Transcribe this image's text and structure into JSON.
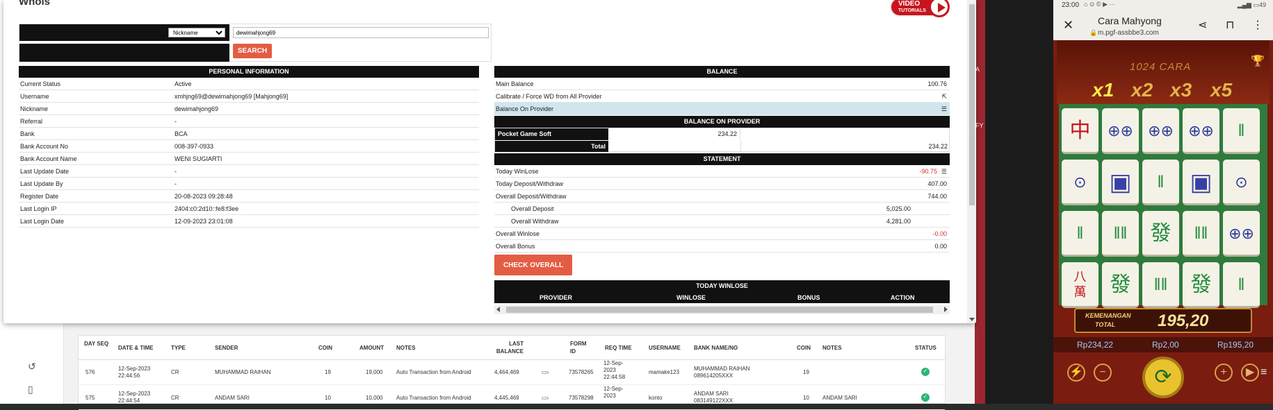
{
  "modal": {
    "title": "Whois",
    "video": {
      "line1": "VIDEO",
      "line2": "TUTORIALS"
    },
    "search": {
      "type_selected": "Nickname",
      "value": "dewimahjong69",
      "button": "SEARCH"
    }
  },
  "personal": {
    "header": "PERSONAL INFORMATION",
    "rows": [
      {
        "k": "Current Status",
        "v": "Active"
      },
      {
        "k": "Username",
        "v": "xmhjng69@dewimahjong69  [Mahjong69]"
      },
      {
        "k": "Nickname",
        "v": "dewimahjong69"
      },
      {
        "k": "Referral",
        "v": "-"
      },
      {
        "k": "Bank",
        "v": "BCA"
      },
      {
        "k": "Bank Account No",
        "v": "008-397-0933"
      },
      {
        "k": "Bank Account Name",
        "v": "WENI SUGIARTI"
      },
      {
        "k": "Last Update Date",
        "v": "-"
      },
      {
        "k": "Last Update By",
        "v": "-"
      },
      {
        "k": "Register Date",
        "v": "20-08-2023 09:28:48"
      },
      {
        "k": "Last Login IP",
        "v": "2404:c0:2d10::fe8:f3ee"
      },
      {
        "k": "Last Login Date",
        "v": "12-09-2023 23:01:08"
      }
    ]
  },
  "balance": {
    "header": "BALANCE",
    "main_k": "Main Balance",
    "main_v": "100.76",
    "calibrate_k": "Calibrate / Force WD from All Provider",
    "onprov_k": "Balance On Provider",
    "onprov_header": "BALANCE ON PROVIDER",
    "provider_name": "Pocket Game Soft",
    "provider_val": "234.22",
    "total_k": "Total",
    "total_v": "234.22"
  },
  "statement": {
    "header": "STATEMENT",
    "today_winlose_k": "Today WinLose",
    "today_winlose_v": "-90.75",
    "today_dw_k": "Today Deposit/Withdraw",
    "today_dw_v": "407.00",
    "overall_dw_k": "Overall Deposit/Withdraw",
    "overall_dw_v": "744.00",
    "overall_dep_k": "Overall Deposit",
    "overall_dep_v": "5,025.00",
    "overall_wd_k": "Overall Withdraw",
    "overall_wd_v": "4,281.00",
    "overall_winlose_k": "Overall Winlose",
    "overall_winlose_v": "-0.00",
    "overall_bonus_k": "Overall Bonus",
    "overall_bonus_v": "0.00",
    "check_button": "CHECK OVERALL"
  },
  "today_winlose": {
    "header": "TODAY WINLOSE",
    "columns": [
      "PROVIDER",
      "WINLOSE",
      "BONUS",
      "ACTION"
    ]
  },
  "transactions": {
    "headers": {
      "day_seq": "DAY SEQ",
      "datetime": "DATE & TIME",
      "type": "TYPE",
      "sender": "SENDER",
      "coin": "COIN",
      "amount": "AMOUNT",
      "notes": "NOTES",
      "last_balance": "LAST BALANCE",
      "form_id": "FORM ID",
      "req_time": "REQ TIME",
      "username": "USERNAME",
      "bank": "BANK NAME/NO",
      "coin2": "COIN",
      "notes2": "NOTES",
      "status": "STATUS"
    },
    "rows": [
      {
        "seq": "576",
        "date": "12-Sep-2023",
        "time": "22:44:56",
        "type": "CR",
        "sender": "MUHAMMAD RAIHAN",
        "coin": "19",
        "amount": "19,000",
        "notes": "Auto Transaction from Android",
        "balance": "4,464,469",
        "form": "73578265",
        "req1": "12-Sep-",
        "req2": "2023",
        "req3": "22:44:58",
        "user": "mamake123",
        "bank1": "MUHAMMAD RAIHAN",
        "bank2": "089614205XXX",
        "coin2": "19",
        "notes2": ""
      },
      {
        "seq": "575",
        "date": "12-Sep-2023",
        "time": "22:44:54",
        "type": "CR",
        "sender": "ANDAM SARI",
        "coin": "10",
        "amount": "10,000",
        "notes": "Auto Transaction from Android",
        "balance": "4,445,469",
        "form": "73578298",
        "req1": "12-Sep-",
        "req2": "2023",
        "req3": "",
        "user": "konto",
        "bank1": "ANDAM SARI",
        "bank2": "083149122XXX",
        "coin2": "10",
        "notes2": "ANDAM SARI"
      }
    ]
  },
  "right_strip": {
    "chars": [
      "A",
      "FY"
    ]
  },
  "phone": {
    "time": "23:00",
    "battery": "49",
    "title": "Cara Mahyong",
    "url": "m.pgf-assbbe3.com",
    "game": {
      "banner": "1024 CARA",
      "multipliers": [
        "x1",
        "x2",
        "x3",
        "x5"
      ],
      "win_label_1": "KEMENANGAN",
      "win_label_2": "TOTAL",
      "win_amount": "195,20",
      "balance": "Rp234,22",
      "bet": "Rp2,00",
      "win": "Rp195,20",
      "turbo": "TURBO",
      "auto": "AUTO"
    }
  }
}
